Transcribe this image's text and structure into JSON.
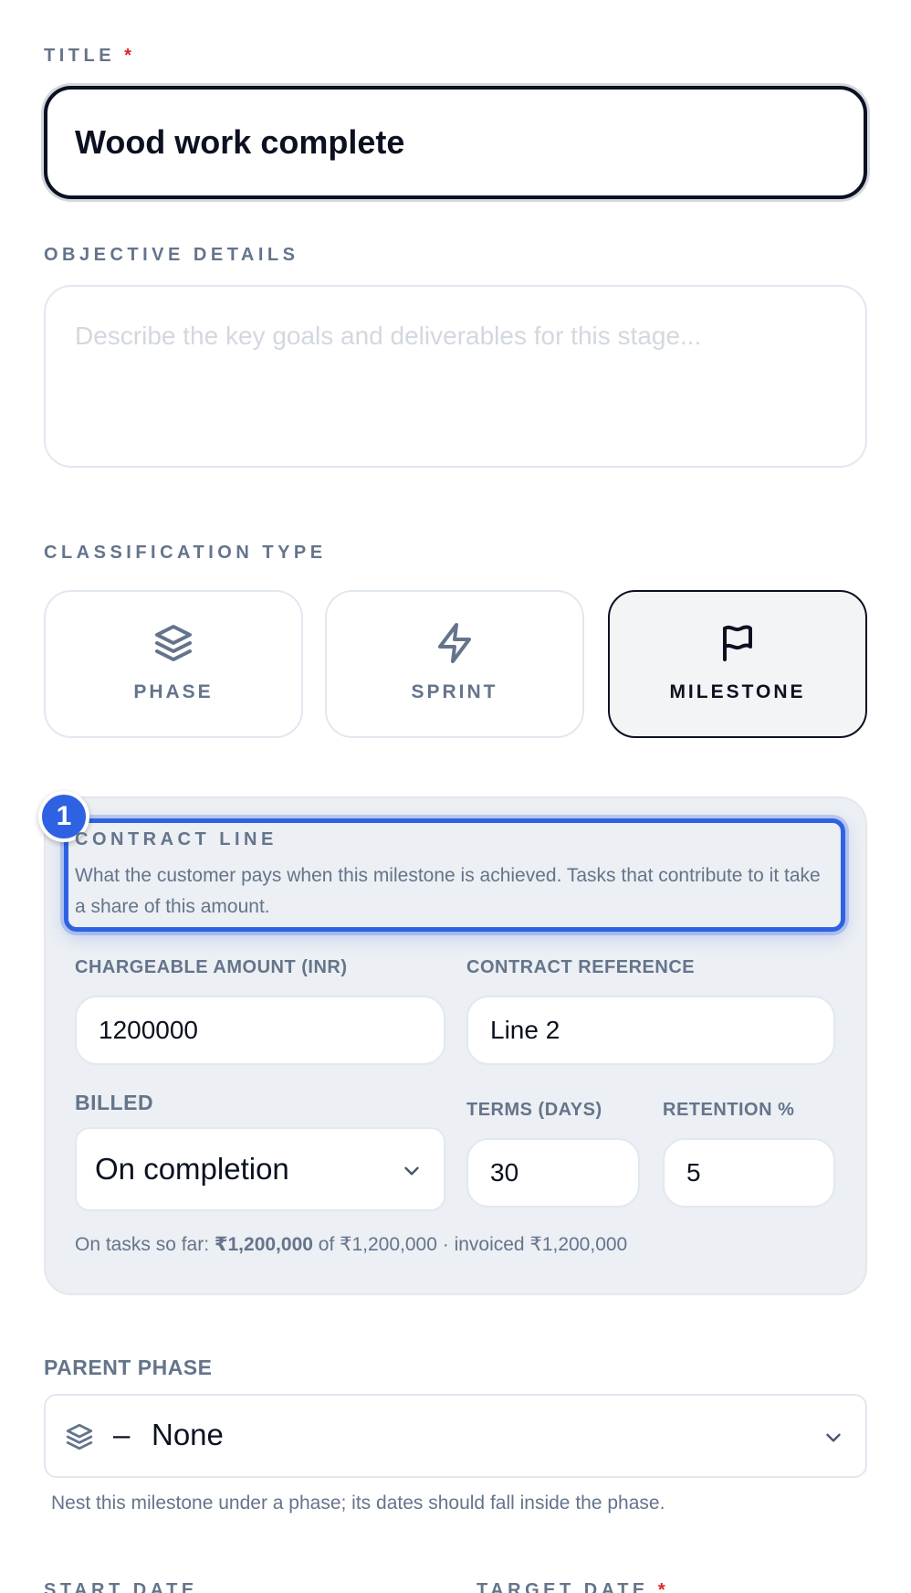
{
  "title_field": {
    "label": "TITLE",
    "required_mark": "*",
    "value": "Wood work complete"
  },
  "objective": {
    "label": "OBJECTIVE DETAILS",
    "placeholder": "Describe the key goals and deliverables for this stage..."
  },
  "classification": {
    "label": "CLASSIFICATION TYPE",
    "options": [
      {
        "label": "PHASE",
        "icon": "layers-icon",
        "selected": false
      },
      {
        "label": "SPRINT",
        "icon": "lightning-icon",
        "selected": false
      },
      {
        "label": "MILESTONE",
        "icon": "flag-icon",
        "selected": true
      }
    ]
  },
  "contract": {
    "badge": "1",
    "title": "CONTRACT LINE",
    "description": "What the customer pays when this milestone is achieved. Tasks that contribute to it take a share of this amount.",
    "amount_label": "CHARGEABLE AMOUNT (INR)",
    "amount_value": "1200000",
    "reference_label": "CONTRACT REFERENCE",
    "reference_value": "Line 2",
    "billed_label": "BILLED",
    "billed_value": "On completion",
    "terms_label": "TERMS (DAYS)",
    "terms_value": "30",
    "retention_label": "RETENTION %",
    "retention_value": "5",
    "summary_prefix": "On tasks so far: ",
    "summary_bold": "₹1,200,000",
    "summary_suffix": " of ₹1,200,000 · invoiced ₹1,200,000"
  },
  "parent_phase": {
    "label": "PARENT PHASE",
    "dash": "–",
    "value": "None",
    "hint": "Nest this milestone under a phase; its dates should fall inside the phase."
  },
  "dates": {
    "start_label": "START DATE",
    "target_label": "TARGET DATE",
    "required_mark": "*"
  },
  "colors": {
    "accent": "#2f62e3",
    "label": "#64748b",
    "required": "#dc2626",
    "panel": "#eceff3"
  }
}
